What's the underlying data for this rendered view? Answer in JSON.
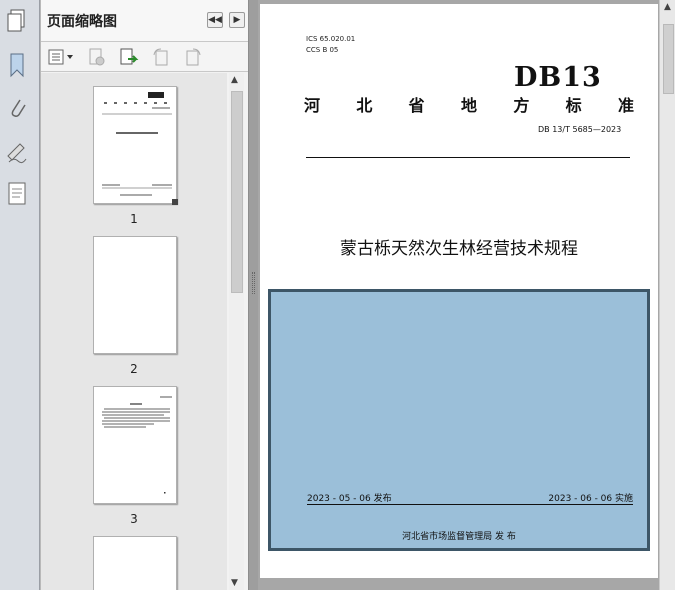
{
  "panel": {
    "title": "页面缩略图"
  },
  "thumbnails": [
    {
      "label": "1"
    },
    {
      "label": "2"
    },
    {
      "label": "3"
    }
  ],
  "document": {
    "ics": "ICS  65.020.01",
    "ccs": "CCS  B  05",
    "db_mark": "DB13",
    "province_chars": [
      "河",
      "北",
      "省",
      "地",
      "方",
      "标",
      "准"
    ],
    "standard_number": "DB 13/T  5685—2023",
    "title": "蒙古栎天然次生林经营技术规程",
    "issue_date": "2023 - 05 - 06 发布",
    "effective_date": "2023 - 06 - 06 实施",
    "publisher": "河北省市场监督管理局      发  布"
  },
  "colors": {
    "cover_block": "#9bbfd9",
    "cover_border": "#3d5667"
  }
}
